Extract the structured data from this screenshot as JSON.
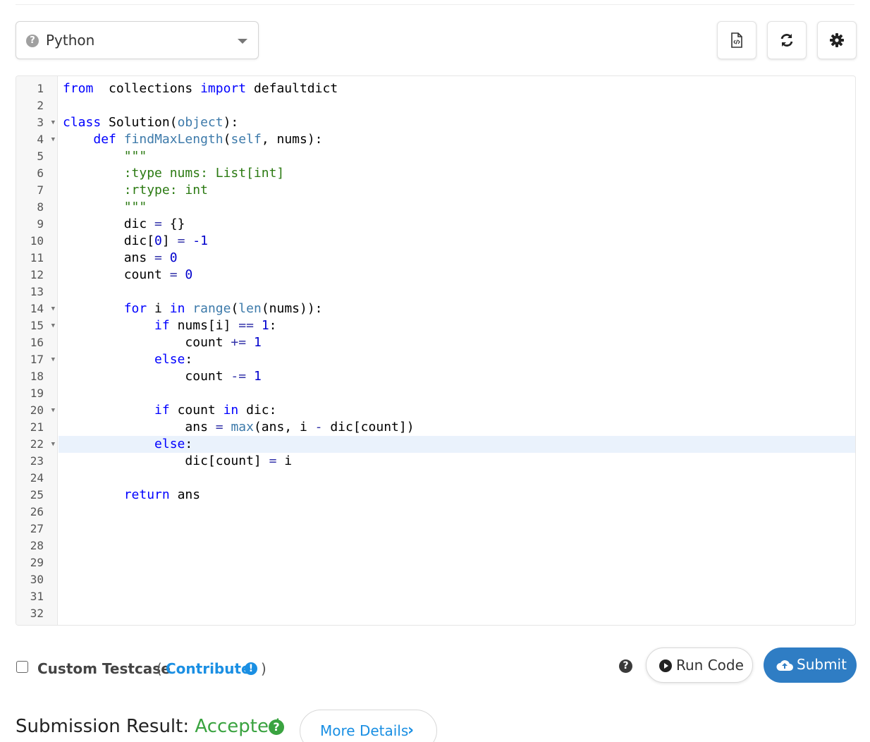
{
  "toolbar": {
    "language": "Python",
    "buttons": [
      "file-code-icon",
      "refresh-icon",
      "gear-icon"
    ]
  },
  "editor": {
    "active_line": 22,
    "gutter": [
      {
        "n": "1",
        "fold": ""
      },
      {
        "n": "2",
        "fold": ""
      },
      {
        "n": "3",
        "fold": "▼"
      },
      {
        "n": "4",
        "fold": "▼"
      },
      {
        "n": "5",
        "fold": ""
      },
      {
        "n": "6",
        "fold": ""
      },
      {
        "n": "7",
        "fold": ""
      },
      {
        "n": "8",
        "fold": ""
      },
      {
        "n": "9",
        "fold": ""
      },
      {
        "n": "10",
        "fold": ""
      },
      {
        "n": "11",
        "fold": ""
      },
      {
        "n": "12",
        "fold": ""
      },
      {
        "n": "13",
        "fold": ""
      },
      {
        "n": "14",
        "fold": "▼"
      },
      {
        "n": "15",
        "fold": "▼"
      },
      {
        "n": "16",
        "fold": ""
      },
      {
        "n": "17",
        "fold": "▼"
      },
      {
        "n": "18",
        "fold": ""
      },
      {
        "n": "19",
        "fold": ""
      },
      {
        "n": "20",
        "fold": "▼"
      },
      {
        "n": "21",
        "fold": ""
      },
      {
        "n": "22",
        "fold": "▼"
      },
      {
        "n": "23",
        "fold": ""
      },
      {
        "n": "24",
        "fold": ""
      },
      {
        "n": "25",
        "fold": ""
      },
      {
        "n": "26",
        "fold": ""
      },
      {
        "n": "27",
        "fold": ""
      },
      {
        "n": "28",
        "fold": ""
      },
      {
        "n": "29",
        "fold": ""
      },
      {
        "n": "30",
        "fold": ""
      },
      {
        "n": "31",
        "fold": ""
      },
      {
        "n": "32",
        "fold": ""
      }
    ],
    "lines": [
      [
        [
          "kw",
          "from"
        ],
        [
          "",
          "  collections "
        ],
        [
          "kw",
          "import"
        ],
        [
          "",
          " defaultdict"
        ]
      ],
      [],
      [
        [
          "kw",
          "class"
        ],
        [
          "",
          " Solution("
        ],
        [
          "bi",
          "object"
        ],
        [
          "",
          "):"
        ]
      ],
      [
        [
          "",
          "    "
        ],
        [
          "kw",
          "def"
        ],
        [
          "",
          " "
        ],
        [
          "bi",
          "findMaxLength"
        ],
        [
          "",
          "("
        ],
        [
          "bi",
          "self"
        ],
        [
          "",
          ", nums):"
        ]
      ],
      [
        [
          "st",
          "        \"\"\""
        ]
      ],
      [
        [
          "st",
          "        :type nums: List[int]"
        ]
      ],
      [
        [
          "st",
          "        :rtype: int"
        ]
      ],
      [
        [
          "st",
          "        \"\"\""
        ]
      ],
      [
        [
          "",
          "        dic "
        ],
        [
          "op",
          "="
        ],
        [
          "",
          " {}"
        ]
      ],
      [
        [
          "",
          "        dic["
        ],
        [
          "nu",
          "0"
        ],
        [
          "",
          "] "
        ],
        [
          "op",
          "="
        ],
        [
          "",
          " "
        ],
        [
          "nu",
          "-1"
        ]
      ],
      [
        [
          "",
          "        ans "
        ],
        [
          "op",
          "="
        ],
        [
          "",
          " "
        ],
        [
          "nu",
          "0"
        ]
      ],
      [
        [
          "",
          "        count "
        ],
        [
          "op",
          "="
        ],
        [
          "",
          " "
        ],
        [
          "nu",
          "0"
        ]
      ],
      [],
      [
        [
          "",
          "        "
        ],
        [
          "kw",
          "for"
        ],
        [
          "",
          " i "
        ],
        [
          "kw",
          "in"
        ],
        [
          "",
          " "
        ],
        [
          "bi",
          "range"
        ],
        [
          "",
          "("
        ],
        [
          "bi",
          "len"
        ],
        [
          "",
          "(nums)):"
        ]
      ],
      [
        [
          "",
          "            "
        ],
        [
          "kw",
          "if"
        ],
        [
          "",
          " nums[i] "
        ],
        [
          "op",
          "=="
        ],
        [
          "",
          " "
        ],
        [
          "nu",
          "1"
        ],
        [
          "",
          ":"
        ]
      ],
      [
        [
          "",
          "                count "
        ],
        [
          "op",
          "+="
        ],
        [
          "",
          " "
        ],
        [
          "nu",
          "1"
        ]
      ],
      [
        [
          "",
          "            "
        ],
        [
          "kw",
          "else"
        ],
        [
          "",
          ":"
        ]
      ],
      [
        [
          "",
          "                count "
        ],
        [
          "op",
          "-="
        ],
        [
          "",
          " "
        ],
        [
          "nu",
          "1"
        ]
      ],
      [],
      [
        [
          "",
          "            "
        ],
        [
          "kw",
          "if"
        ],
        [
          "",
          " count "
        ],
        [
          "kw",
          "in"
        ],
        [
          "",
          " dic:"
        ]
      ],
      [
        [
          "",
          "                ans "
        ],
        [
          "op",
          "="
        ],
        [
          "",
          " "
        ],
        [
          "bi",
          "max"
        ],
        [
          "",
          "(ans, i "
        ],
        [
          "op",
          "-"
        ],
        [
          "",
          " dic[count])"
        ]
      ],
      [
        [
          "",
          "            "
        ],
        [
          "kw",
          "else"
        ],
        [
          "",
          ":"
        ]
      ],
      [
        [
          "",
          "                dic[count] "
        ],
        [
          "op",
          "="
        ],
        [
          "",
          " i"
        ]
      ],
      [],
      [
        [
          "",
          "        "
        ],
        [
          "kw",
          "return"
        ],
        [
          "",
          " ans"
        ]
      ],
      [],
      [],
      [],
      [],
      [],
      [],
      []
    ]
  },
  "footer": {
    "custom_testcase_label": "Custom Testcase",
    "paren_open": "(",
    "contribute_label": "Contribute",
    "paren_close": ")",
    "run_label": "Run Code",
    "submit_label": "Submit"
  },
  "result": {
    "label": "Submission Result:",
    "status": "Accepted",
    "details_label": "More Details"
  }
}
